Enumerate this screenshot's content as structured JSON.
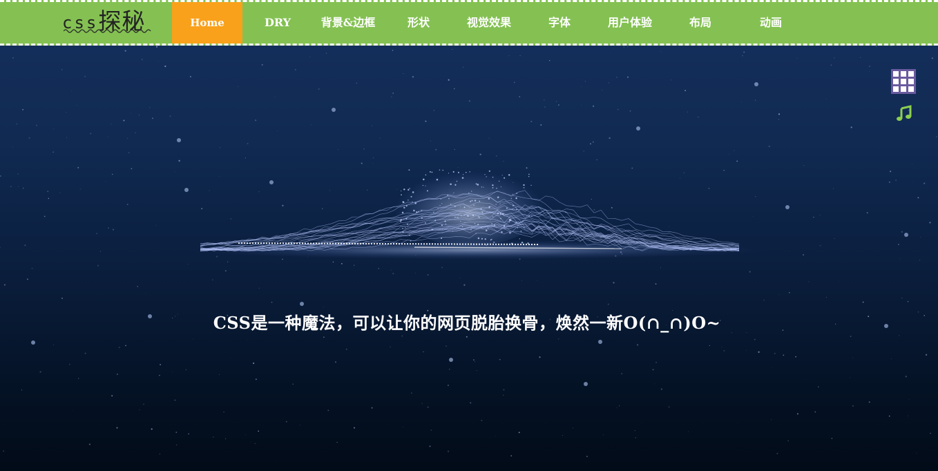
{
  "logo": {
    "latin": "css",
    "cjk": "探秘"
  },
  "nav": {
    "items": [
      {
        "label": "Home",
        "active": true
      },
      {
        "label": "DRY",
        "active": false
      },
      {
        "label": "背景&边框",
        "active": false
      },
      {
        "label": "形状",
        "active": false
      },
      {
        "label": "视觉效果",
        "active": false
      },
      {
        "label": "字体",
        "active": false
      },
      {
        "label": "用户体验",
        "active": false
      },
      {
        "label": "布局",
        "active": false
      },
      {
        "label": "动画",
        "active": false
      }
    ]
  },
  "hero": {
    "tagline": "CSS是一种魔法，可以让你的网页脱胎换骨，焕然一新O(∩_∩)O~"
  },
  "side_icons": [
    "grid-menu-icon",
    "music-note-icon"
  ],
  "colors": {
    "navbar_bg": "#84c152",
    "active_tab_bg": "#f9a11b",
    "background_top": "#15305e",
    "background_bottom": "#020b18",
    "grid_icon": "#6a5a9e",
    "music_icon": "#8ccf50"
  }
}
